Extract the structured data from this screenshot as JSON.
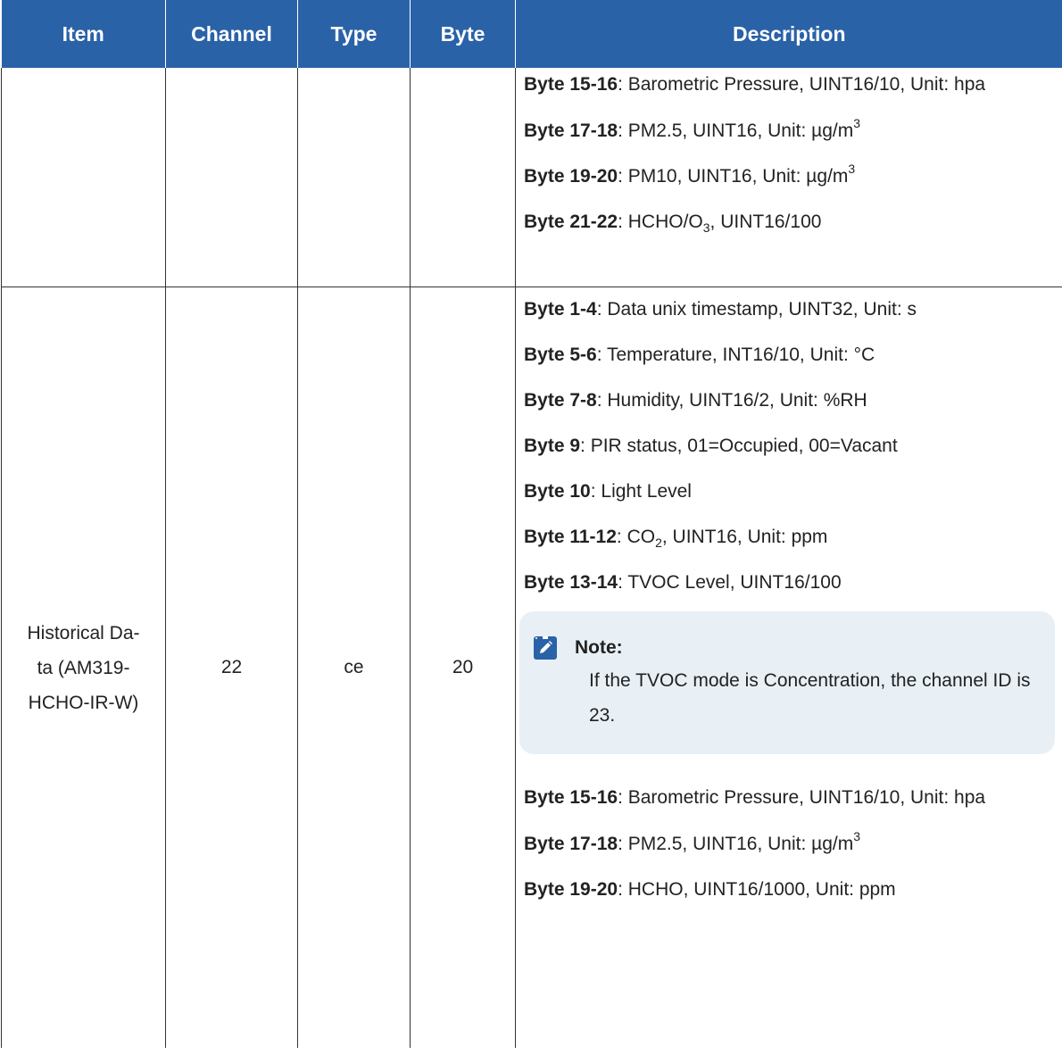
{
  "header": {
    "item": "Item",
    "channel": "Channel",
    "type": "Type",
    "byte": "Byte",
    "description": "Description"
  },
  "row1": {
    "lines": [
      {
        "label": "Byte 15-16",
        "text": ": Barometric Pressure, UINT16/10, Unit: hpa"
      },
      {
        "label": "Byte 17-18",
        "text": ": PM2.5, UINT16, Unit: µg/m",
        "sup": "3"
      },
      {
        "label": "Byte 19-20",
        "text": ": PM10, UINT16, Unit: µg/m",
        "sup": "3"
      },
      {
        "label": "Byte 21-22",
        "text_pre": ": HCHO/O",
        "sub": "3",
        "text_post": ", UINT16/100"
      }
    ]
  },
  "row2": {
    "item": "Historical Da-ta (AM319-HCHO-IR-W)",
    "item_lines": [
      "Historical Da-",
      "ta (AM319-",
      "HCHO-IR-W)"
    ],
    "channel": "22",
    "type": "ce",
    "byte": "20",
    "lines_before_note": [
      {
        "label": "Byte 1-4",
        "text": ": Data unix timestamp, UINT32, Unit: s"
      },
      {
        "label": "Byte 5-6",
        "text": ": Temperature, INT16/10, Unit: °C"
      },
      {
        "label": "Byte 7-8",
        "text": ": Humidity, UINT16/2, Unit: %RH"
      },
      {
        "label": "Byte 9",
        "text": ": PIR status, 01=Occupied, 00=Vacant"
      },
      {
        "label": "Byte 10",
        "text": ": Light Level"
      },
      {
        "label": "Byte 11-12",
        "text_pre": ": CO",
        "sub": "2",
        "text_post": ", UINT16, Unit: ppm"
      },
      {
        "label": "Byte 13-14",
        "text": ": TVOC Level, UINT16/100"
      }
    ],
    "note": {
      "icon": "pencil-note-icon",
      "title": "Note:",
      "body": "If the TVOC mode is Concentration, the channel ID is 23."
    },
    "lines_after_note": [
      {
        "label": "Byte 15-16",
        "text": ": Barometric Pressure, UINT16/10, Unit: hpa"
      },
      {
        "label": "Byte 17-18",
        "text": ": PM2.5, UINT16, Unit: µg/m",
        "sup": "3"
      },
      {
        "label": "Byte 19-20",
        "text": ": HCHO, UINT16/1000, Unit: ppm"
      }
    ]
  },
  "colors": {
    "header_bg": "#2a62a8",
    "header_text": "#ffffff",
    "note_bg": "#e8f0f6",
    "border": "#333333"
  }
}
